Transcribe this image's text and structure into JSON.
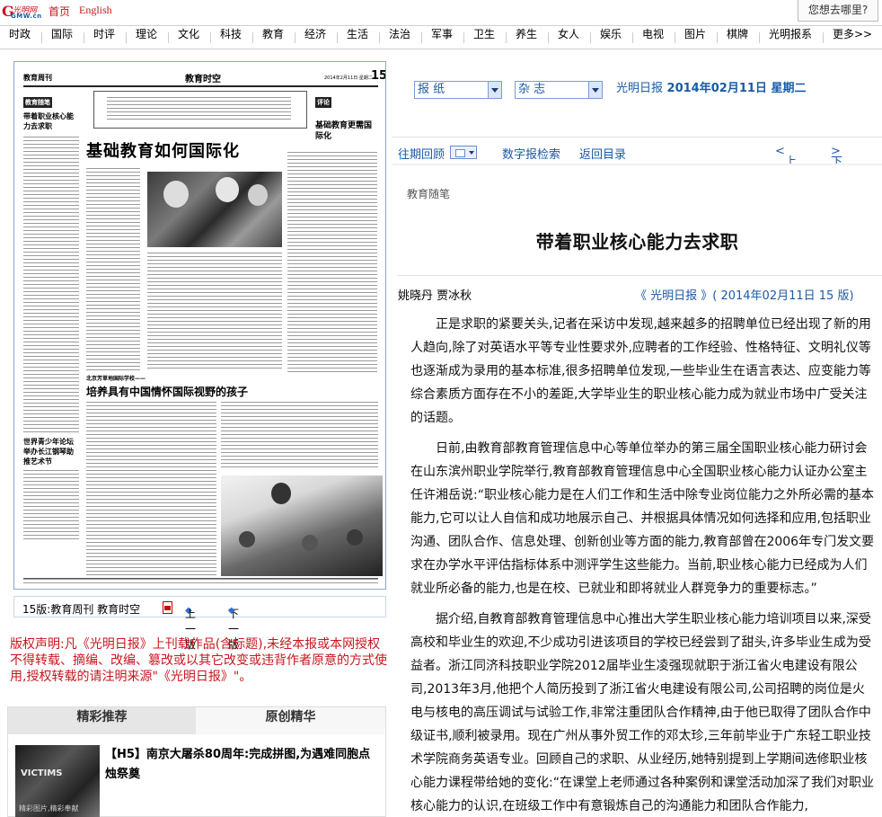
{
  "topbar": {
    "logo_text": "光明网",
    "logo_sub": "GMW.cn",
    "home_label": "首页",
    "english_label": "English",
    "search_label": "您想去哪里?"
  },
  "nav": {
    "items": [
      "时政",
      "国际",
      "时评",
      "理论",
      "文化",
      "科技",
      "教育",
      "经济",
      "生活",
      "法治",
      "军事",
      "卫生",
      "养生",
      "女人",
      "娱乐",
      "电视",
      "图片",
      "棋牌",
      "光明报系",
      "更多>>"
    ]
  },
  "paper_page": {
    "header_left": "教育周刊",
    "header_center": "教育时空",
    "header_right": "15",
    "header_date": "2014年2月11日  星期二",
    "left_label": "教育随笔",
    "left_title": "带着职业核心能力去求职",
    "right_label": "评论",
    "right_title": "基础教育更需国际化",
    "main_title": "基础教育如何国际化",
    "sub_kicker": "北京芳草地国际学校——",
    "sub_title": "培养具有中国情怀国际视野的孩子",
    "left_bottom_title": "世界青少年论坛举办长江钢琴助推艺术节"
  },
  "pagenav": {
    "edition": "15版:教育周刊 教育时空",
    "prev_label": "上一版",
    "next_label": "下一版"
  },
  "copyright": "版权声明:凡《光明日报》上刊载作品(含标题),未经本报或本网授权不得转载、摘编、改编、篡改或以其它改变或违背作者原意的方式使用,授权转载的请注明来源\"《光明日报》\"。",
  "recommend": {
    "tabs": [
      "精彩推荐",
      "原创精华"
    ],
    "thumb_text": "VICTIMS",
    "thumb_caption": "精彩图片,精彩奉献",
    "headline": "【H5】南京大屠杀80周年:完成拼图,为遇难同胞点烛祭奠"
  },
  "controls": {
    "select_paper": "报 纸",
    "select_magazine": "杂 志",
    "paper_name": "光明日报",
    "date": "2014年02月11日",
    "weekday": "星期二",
    "back_issues": "往期回顾",
    "digital_search": "数字报检索",
    "return_toc": "返回目录",
    "prev_issue": "上一期",
    "next_issue": "下一期"
  },
  "article": {
    "column": "教育随笔",
    "title": "带着职业核心能力去求职",
    "authors": "姚晓丹  贾冰秋",
    "source": "《 光明日报 》( 2014年02月11日   15 版)",
    "paragraphs": [
      "正是求职的紧要关头,记者在采访中发现,越来越多的招聘单位已经出现了新的用人趋向,除了对英语水平等专业性要求外,应聘者的工作经验、性格特征、文明礼仪等也逐渐成为录用的基本标准,很多招聘单位发现,一些毕业生在语言表达、应变能力等综合素质方面存在不小的差距,大学毕业生的职业核心能力成为就业市场中广受关注的话题。",
      "日前,由教育部教育管理信息中心等单位举办的第三届全国职业核心能力研讨会在山东滨州职业学院举行,教育部教育管理信息中心全国职业核心能力认证办公室主任许湘岳说:“职业核心能力是在人们工作和生活中除专业岗位能力之外所必需的基本能力,它可以让人自信和成功地展示自己、并根据具体情况如何选择和应用,包括职业沟通、团队合作、信息处理、创新创业等方面的能力,教育部曾在2006年专门发文要求在办学水平评估指标体系中测评学生这些能力。当前,职业核心能力已经成为人们就业所必备的能力,也是在校、已就业和即将就业人群竞争力的重要标志。”",
      "据介绍,自教育部教育管理信息中心推出大学生职业核心能力培训项目以来,深受高校和毕业生的欢迎,不少成功引进该项目的学校已经尝到了甜头,许多毕业生成为受益者。浙江同济科技职业学院2012届毕业生凌强现就职于浙江省火电建设有限公司,2013年3月,他把个人简历投到了浙江省火电建设有限公司,公司招聘的岗位是火电与核电的高压调试与试验工作,非常注重团队合作精神,由于他已取得了团队合作中级证书,顺利被录用。现在广州从事外贸工作的邓太珍,三年前毕业于广东轻工职业技术学院商务英语专业。回顾自己的求职、从业经历,她特别提到上学期间选修职业核心能力课程带给她的变化:“在课堂上老师通过各种案例和课堂活动加深了我们对职业核心能力的认识,在班级工作中有意锻炼自己的沟通能力和团队合作能力,"
    ]
  }
}
